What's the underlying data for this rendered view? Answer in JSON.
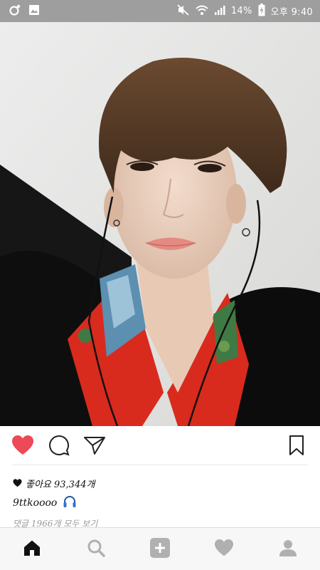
{
  "status_bar": {
    "battery_percent": "14%",
    "time": "오후 9:40",
    "icons": [
      "circle-notification-icon",
      "gallery-icon",
      "mute-icon",
      "wifi-icon",
      "signal-icon",
      "battery-charging-icon"
    ]
  },
  "post": {
    "likes_text": "좋아요 93,344개",
    "username": "9ttkoooo",
    "username_emoji": "headphones-icon",
    "comments_text": "댓글 1966개 모두 보기"
  },
  "colors": {
    "like_active": "#ed4956",
    "status_bar_bg": "#9e9e9e",
    "nav_icon": "#b0b0b0",
    "nav_icon_active": "#111111"
  },
  "actions": [
    "heart-icon",
    "comment-icon",
    "share-icon",
    "bookmark-icon"
  ],
  "nav": [
    "home-icon",
    "search-icon",
    "add-post-icon",
    "activity-heart-icon",
    "profile-icon"
  ]
}
